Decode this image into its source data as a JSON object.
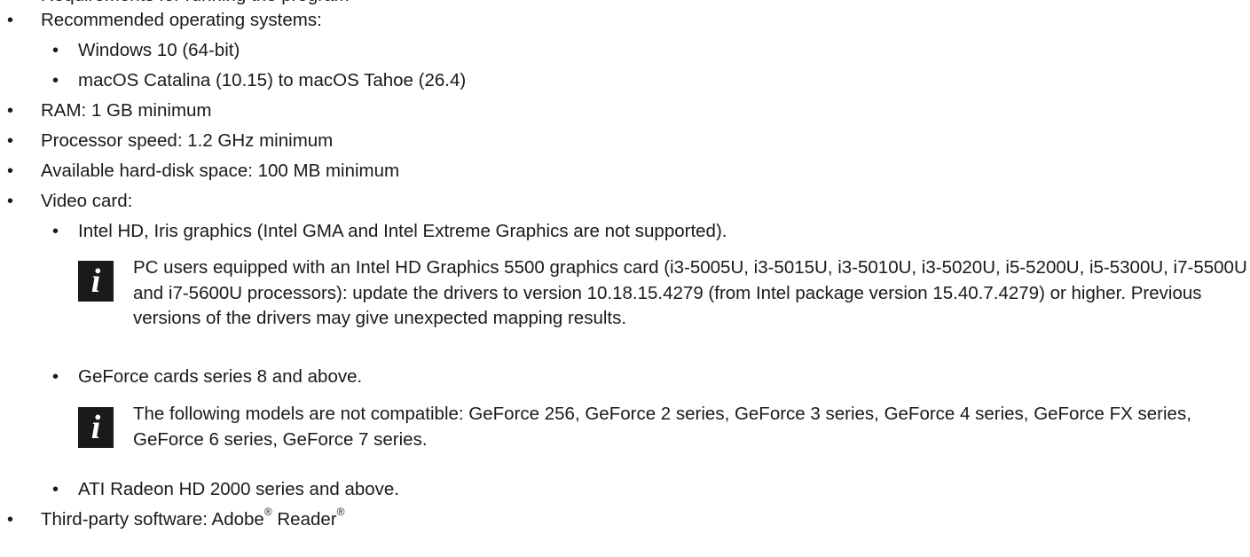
{
  "items": {
    "top_cut": "Requirements for running the program",
    "os_heading": "Recommended operating systems:",
    "os_windows": "Windows 10 (64-bit)",
    "os_mac": "macOS Catalina (10.15) to macOS Tahoe (26.4)",
    "ram": "RAM: 1 GB minimum",
    "processor": "Processor speed: 1.2 GHz minimum",
    "disk": "Available hard-disk space: 100 MB minimum",
    "video_heading": "Video card:",
    "video_intel": "Intel HD, Iris graphics (Intel GMA and Intel Extreme Graphics are not supported).",
    "note_intel": "PC users equipped with an Intel HD Graphics 5500 graphics card (i3-5005U, i3-5015U, i3-5010U, i3-5020U, i5-5200U, i5-5300U, i7-5500U and i7-5600U processors): update the drivers to version 10.18.15.4279 (from Intel package version 15.40.7.4279) or higher. Previous versions of the drivers may give unexpected mapping results.",
    "video_geforce": "GeForce cards series 8 and above.",
    "note_geforce": "The following models are not compatible: GeForce 256, GeForce 2 series, GeForce 3 series, GeForce 4 series, GeForce FX series, GeForce 6 series, GeForce 7 series.",
    "video_ati": "ATI Radeon HD 2000 series and above.",
    "third_party_prefix": "Third-party software: Adobe",
    "third_party_reg1": "®",
    "third_party_reader": " Reader",
    "third_party_reg2": "®"
  },
  "bullet_glyph": "•",
  "info_icon_glyph": "i"
}
